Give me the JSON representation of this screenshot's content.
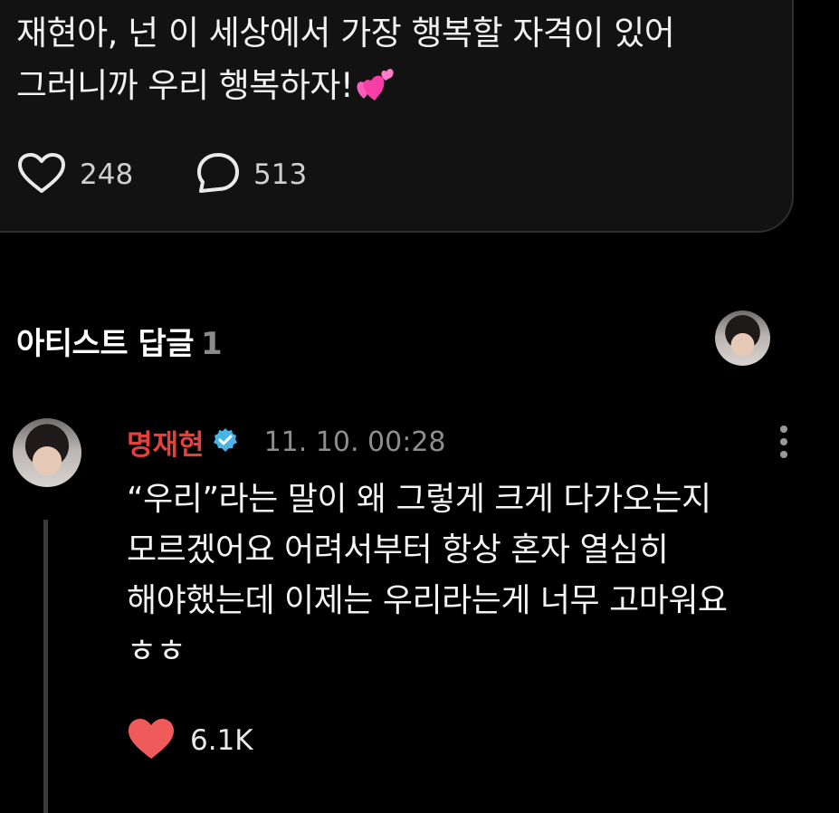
{
  "post": {
    "lines": [
      "재현아, 넌 이 세상에서 가장 행복할 자격이 있어",
      "그러니까 우리 행복하자!"
    ],
    "emoji": "two-hearts-emoji",
    "like_icon": "heart-outline-icon",
    "like_count": "248",
    "comment_icon": "speech-bubble-icon",
    "comment_count": "513"
  },
  "artist_replies": {
    "title": "아티스트 답글",
    "count": "1"
  },
  "reply": {
    "author": "명재현",
    "author_color": "#e5413a",
    "verified_icon": "verified-badge-icon",
    "timestamp": "11. 10. 00:28",
    "menu_icon": "more-vertical-icon",
    "lines": [
      "“우리”라는 말이 왜 그렇게 크게 다가오는지",
      "모르겠어요 어려서부터 항상 혼자 열심히",
      "해야했는데 이제는 우리라는게 너무 고마워요",
      "ㅎㅎ"
    ],
    "like_icon": "heart-filled-icon",
    "like_color": "#ef5b5b",
    "like_count": "6.1K"
  }
}
